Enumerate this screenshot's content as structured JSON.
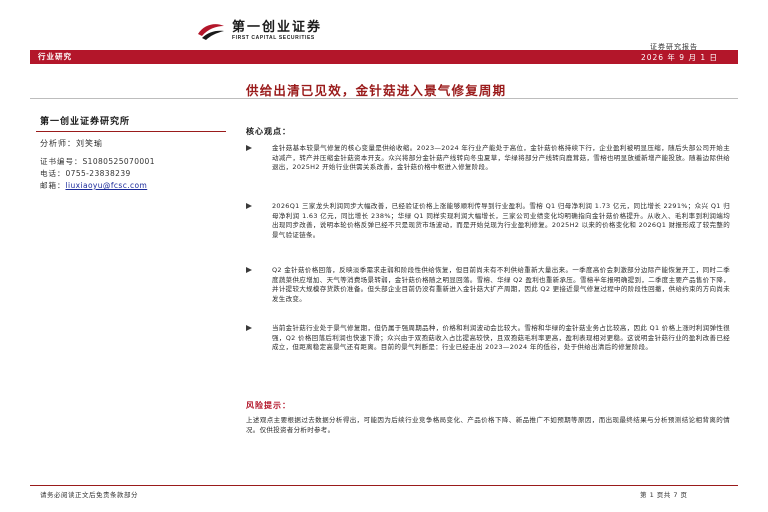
{
  "header": {
    "logo_cn": "第一创业证券",
    "logo_en": "FIRST CAPITAL SECURITIES",
    "report_type": "证券研究报告"
  },
  "banner": {
    "category": "行业研究",
    "date": "2026 年 9 月 1 日"
  },
  "title": "供给出清已见效，金针菇进入景气修复周期",
  "sidebar": {
    "institute": "第一创业证券研究所",
    "analyst": "分析师：刘笑瑜",
    "cert_label": "证书编号：",
    "cert_value": "S1080525070001",
    "phone_label": "电话：",
    "phone_value": "0755-23838239",
    "email_label": "邮箱：",
    "email_value": "liuxiaoyu@fcsc.com"
  },
  "core": {
    "heading": "核心观点：",
    "bullets": [
      "金针菇基本较景气修复的核心变量是供给收缩。2023—2024 年行业产能处于高位，金针菇价格持续下行，企业盈利被明显压缩，随后头部公司开始主动减产，转产并压缩金针菇资本开支。众兴将部分金针菇产线转向冬虫夏草，华绿将部分产线转向鹿茸菇，雪榕也明显放缓新增产能投放。随着边际供给退出，2025H2 开始行业供需关系改善，金针菇价格中枢进入修复阶段。",
      "2026Q1 三家龙头利润同步大幅改善，已经验证价格上涨能够顺利传导到行业盈利。雪榕 Q1 归母净利润 1.73 亿元，同比增长 2291%；众兴 Q1 归母净利润 1.63 亿元，同比增长 238%；华绿 Q1 同样实现利润大幅增长，三家公司业绩变化均明确指向金针菇价格提升。从收入、毛利率到利润端均出现同步改善，说明本轮价格反弹已经不只是现货市场波动，而是开始兑现为行业盈利修复。2025H2 以来的价格变化和 2026Q1 财报形成了较完整的景气验证链条。",
      "Q2 金针菇价格回落，反映淡季需求走弱和阶段性供给恢复，但目前尚未有不利供给重新大量出来。一季度高价会刺激部分边际产能恢复开工，同时二季度蔬菜供应增加、天气等消费场景转弱，金针菇价格随之明显回落。雪榕、华绿 Q2 盈利也重新承压。雪榕半年报明确提到，二季度主要产品售价下降，并计提较大规模存货跌价准备。但头部企业目前仍没有重新进入金针菇大扩产周期，因此 Q2 更接近景气修复过程中的阶段性回撤，供给约束的方向尚未发生改变。",
      "当前金针菇行业处于景气修复期，但仍属于强周期品种，价格和利润波动会比较大。雪榕和华绿的金针菇业务占比较高，因此 Q1 价格上涨时利润弹性很强，Q2 价格回落后利润也快速下滑；众兴由于双孢菇收入占比提高较快，且双孢菇毛利率更高，盈利表现相对更稳。这说明金针菇行业的盈利改善已经成立，但距离稳定高景气还有距离。目前的景气判断是：行业已经走出 2023—2024 年的低谷，处于供给出清后的修复阶段。"
    ]
  },
  "risk": {
    "heading": "风险提示：",
    "text": "上述观点主要根据过去数据分析得出，可能因为后续行业竞争格局变化、产品价格下降、新品推广不如预期等原因，而出现最终结果与分析预测结论相背离的情况。仅供投资者分析时参考。"
  },
  "footer": {
    "disclaimer": "请务必阅读正文后免责条款部分",
    "page": "第 1 页共 7 页"
  },
  "colors": {
    "brand_red": "#b3162a",
    "title_red": "#9a1b1b"
  }
}
